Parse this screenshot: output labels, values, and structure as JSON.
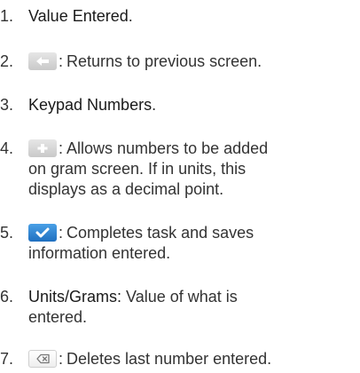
{
  "items": [
    {
      "num": "1.",
      "lead": "Value Entered",
      "rest": "."
    },
    {
      "num": "2.",
      "icon": "back-arrow-icon",
      "rest": "Returns to previous screen."
    },
    {
      "num": "3.",
      "lead": "Keypad Numbers",
      "rest": "."
    },
    {
      "num": "4.",
      "icon": "plus-icon",
      "rest_line1": "Allows numbers to be added",
      "rest_line2": "on gram screen. If in units, this",
      "rest_line3": "displays as a decimal point."
    },
    {
      "num": "5.",
      "icon": "checkmark-icon",
      "rest_line1": "Completes task and saves",
      "rest_line2": "information entered."
    },
    {
      "num": "6.",
      "lead": "Units/Grams:",
      "rest_line1": "Value of what is",
      "rest_line2": "entered."
    },
    {
      "num": "7.",
      "icon": "delete-icon",
      "rest": "Deletes last number entered."
    }
  ],
  "colors": {
    "grey_button": "#d4d4d4",
    "blue_button": "#2b82d1",
    "text": "#333333"
  }
}
